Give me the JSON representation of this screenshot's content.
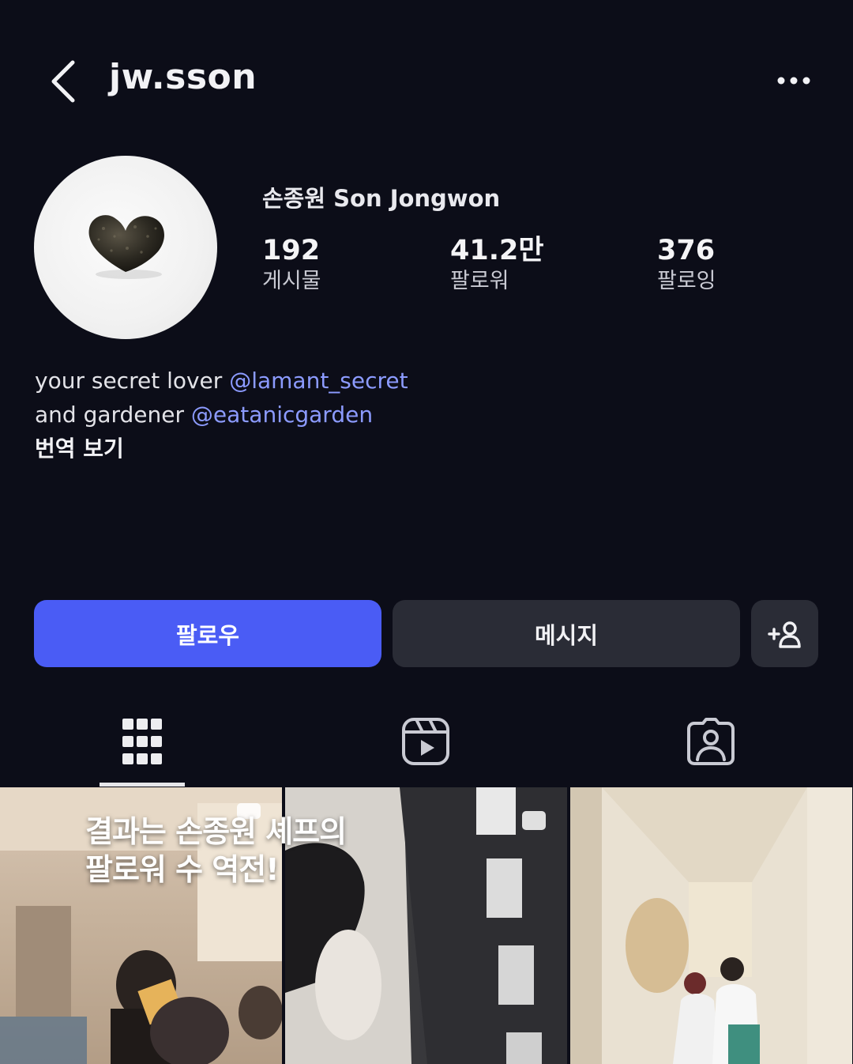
{
  "header": {
    "username": "jw.sson"
  },
  "profile": {
    "display_name": "손종원 Son Jongwon",
    "stats": {
      "posts": {
        "value": "192",
        "label": "게시물"
      },
      "followers": {
        "value": "41.2만",
        "label": "팔로워"
      },
      "following": {
        "value": "376",
        "label": "팔로잉"
      }
    },
    "bio": {
      "line1_text": "your secret lover ",
      "line1_mention": "@lamant_secret",
      "line2_text": "and gardener ",
      "line2_mention": "@eatanicgarden",
      "translate": "번역 보기"
    }
  },
  "actions": {
    "follow": "팔로우",
    "message": "메시지"
  },
  "tabs": [
    "grid",
    "reels",
    "tagged"
  ],
  "overlay": {
    "line1": "결과는 손종원 셰프의",
    "line2": "팔로워 수 역전!"
  },
  "colors": {
    "background": "#0c0d18",
    "follow_button": "#4a5cf5",
    "secondary_button": "#2a2c36",
    "mention": "#8c9bff"
  }
}
